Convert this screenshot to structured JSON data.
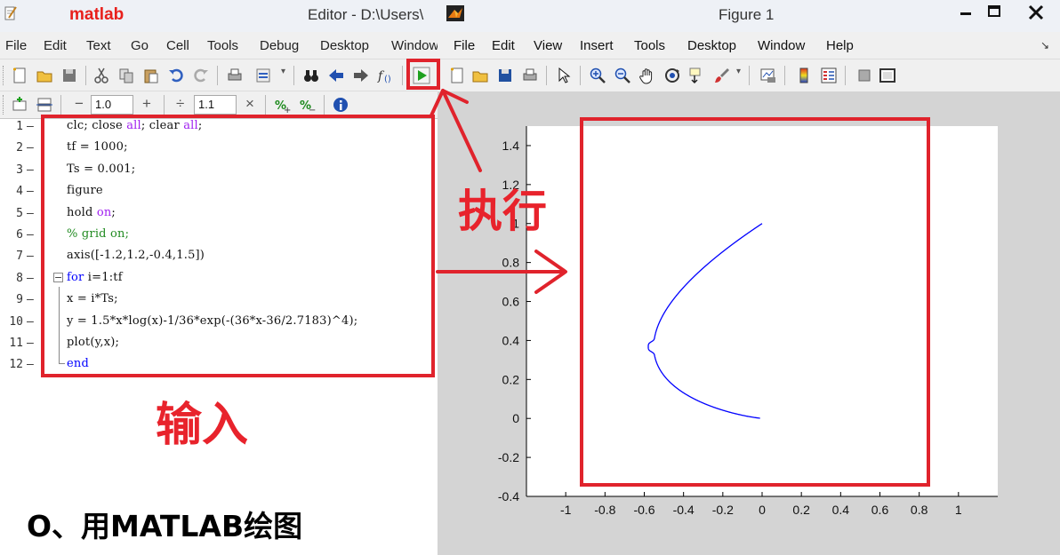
{
  "editor": {
    "brand": "matlab",
    "title": "Editor - D:\\Users\\",
    "menu": [
      "File",
      "Edit",
      "Text",
      "Go",
      "Cell",
      "Tools",
      "Debug",
      "Desktop",
      "Window"
    ],
    "toolbar2": {
      "minus": "−",
      "value1": "1.0",
      "plus": "+",
      "divide": "÷",
      "value2": "1.1",
      "times": "×"
    },
    "code_lines": [
      {
        "n": "1",
        "t": "clc; close <s>all</s>; clear <s>all</s>;"
      },
      {
        "n": "2",
        "t": "tf = 1000;"
      },
      {
        "n": "3",
        "t": "Ts = 0.001;"
      },
      {
        "n": "4",
        "t": "figure"
      },
      {
        "n": "5",
        "t": "hold <s>on</s>;"
      },
      {
        "n": "6",
        "t": "<c>% grid on;</c>"
      },
      {
        "n": "7",
        "t": "axis([-1.2,1.2,-0.4,1.5])"
      },
      {
        "n": "8",
        "t": "<k>for</k> i=1:tf"
      },
      {
        "n": "9",
        "t": "x = i*Ts;"
      },
      {
        "n": "10",
        "t": "y = 1.5*x*log(x)-1/36*exp(-(36*x-36/2.7183)^4);"
      },
      {
        "n": "11",
        "t": "plot(y,x);"
      },
      {
        "n": "12",
        "t": "<k>end</k>"
      }
    ]
  },
  "figure": {
    "title": "Figure 1",
    "menu": [
      "File",
      "Edit",
      "View",
      "Insert",
      "Tools",
      "Desktop",
      "Window",
      "Help"
    ],
    "dock_glyph": "↘"
  },
  "chart_data": {
    "type": "line",
    "title": "",
    "xlabel": "",
    "ylabel": "",
    "xlim": [
      -1.2,
      1.2
    ],
    "ylim": [
      -0.4,
      1.5
    ],
    "x_ticks": [
      "-1",
      "-0.8",
      "-0.6",
      "-0.4",
      "-0.2",
      "0",
      "0.2",
      "0.4",
      "0.6",
      "0.8",
      "1"
    ],
    "y_ticks": [
      "-0.4",
      "-0.2",
      "0",
      "0.2",
      "0.4",
      "0.6",
      "0.8",
      "1",
      "1.2",
      "1.4"
    ],
    "series_color": "#0000ff",
    "grid": false,
    "function": "y = 1.5*x*log(x) - 1/36*exp(-(36*x-36/2.7183)^4); plot(y,x) for x = 0.001..1"
  },
  "annotations": {
    "execute": "执行",
    "input": "输入",
    "caption": "O、用MATLAB绘图",
    "accent": "#e0232c"
  }
}
